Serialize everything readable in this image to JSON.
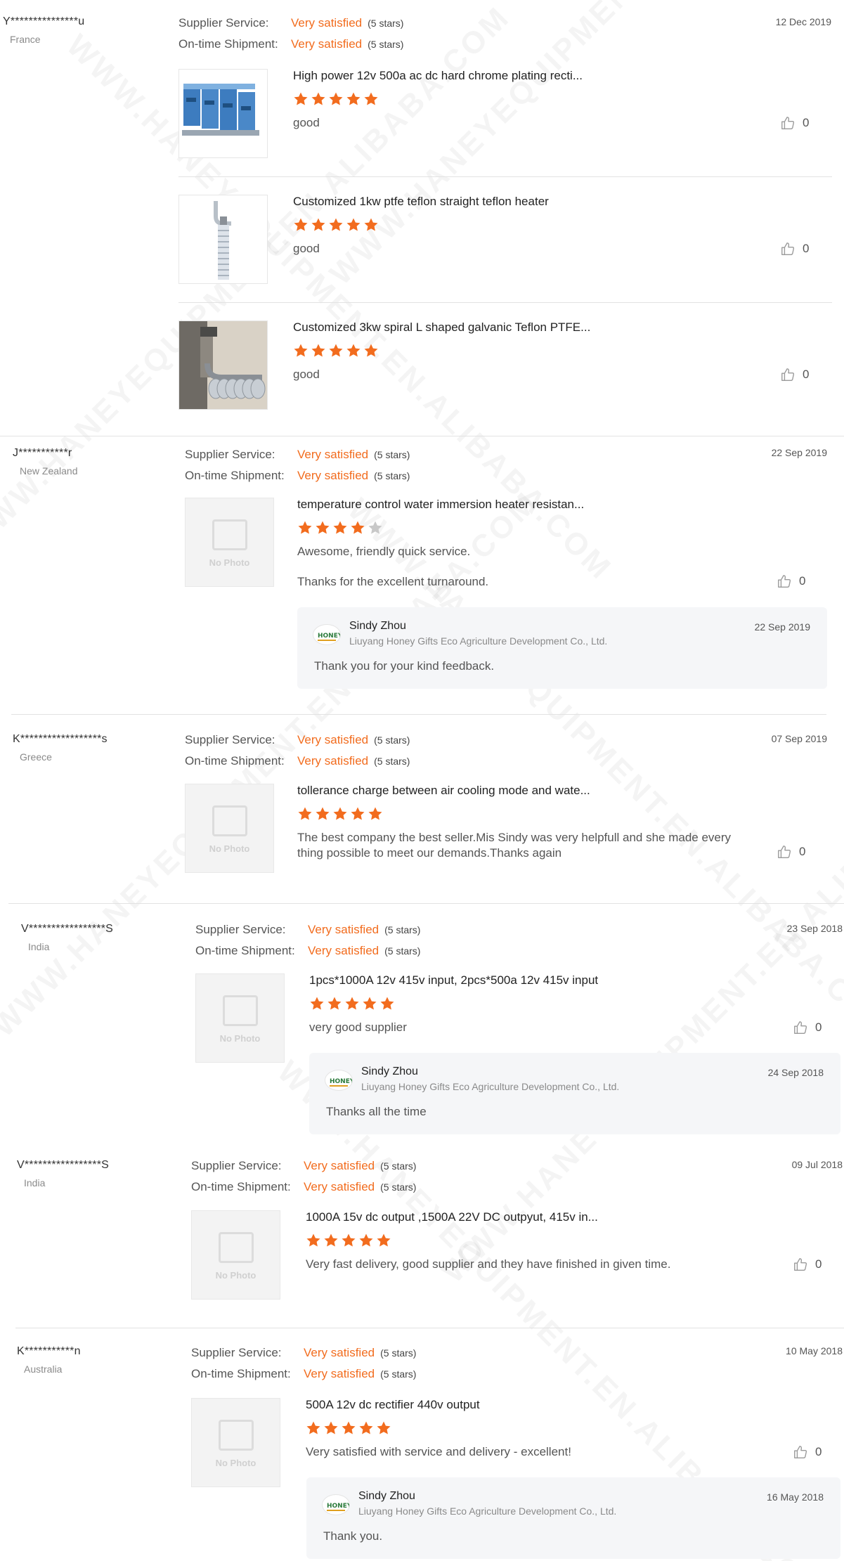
{
  "labels": {
    "supplier_service": "Supplier Service:",
    "ontime_shipment": "On-time Shipment:",
    "no_photo": "No Photo"
  },
  "colors": {
    "accent": "#f26c1e",
    "star_empty": "#c8c8c8"
  },
  "watermark": "WWW.HANEYEQUIPMENT.EN.ALIBABA.COM",
  "reviews": [
    {
      "buyer": "Y***************u",
      "country": "France",
      "date": "12 Dec 2019",
      "supplier_service": "Very satisfied",
      "supplier_service_stars": "(5 stars)",
      "ontime_shipment": "Very satisfied",
      "ontime_shipment_stars": "(5 stars)",
      "products": [
        {
          "title": "High power 12v 500a ac dc hard chrome plating recti...",
          "rating": 5,
          "comment": "good",
          "likes": "0",
          "image": "rectifier-photo"
        },
        {
          "title": "Customized 1kw ptfe teflon straight teflon heater",
          "rating": 5,
          "comment": "good",
          "likes": "0",
          "image": "heater-photo"
        },
        {
          "title": "Customized 3kw spiral L shaped galvanic Teflon PTFE...",
          "rating": 5,
          "comment": "good",
          "likes": "0",
          "image": "spiral-heater-photo"
        }
      ]
    },
    {
      "buyer": "J***********r",
      "country": "New Zealand",
      "date": "22 Sep 2019",
      "supplier_service": "Very satisfied",
      "supplier_service_stars": "(5 stars)",
      "ontime_shipment": "Very satisfied",
      "ontime_shipment_stars": "(5 stars)",
      "products": [
        {
          "title": "temperature control water immersion heater resistan...",
          "rating": 4,
          "comment": "Awesome, friendly quick service.",
          "comment2": "Thanks for the excellent turnaround.",
          "likes": "0",
          "image": "no-photo"
        }
      ],
      "reply": {
        "name": "Sindy Zhou",
        "company": "Liuyang Honey Gifts Eco Agriculture Development Co., Ltd.",
        "date": "22 Sep 2019",
        "text": "Thank  you for your kind feedback."
      }
    },
    {
      "buyer": "K******************s",
      "country": "Greece",
      "date": "07 Sep 2019",
      "supplier_service": "Very satisfied",
      "supplier_service_stars": "(5 stars)",
      "ontime_shipment": "Very satisfied",
      "ontime_shipment_stars": "(5 stars)",
      "products": [
        {
          "title": "tollerance charge between air cooling mode and wate...",
          "rating": 5,
          "comment": "The best company the best seller.Mis Sindy was very helpfull and she made every thing possible to meet our demands.Thanks again",
          "likes": "0",
          "image": "no-photo"
        }
      ]
    },
    {
      "buyer": "V*****************S",
      "country": "India",
      "date": "23 Sep 2018",
      "supplier_service": "Very satisfied",
      "supplier_service_stars": "(5 stars)",
      "ontime_shipment": "Very satisfied",
      "ontime_shipment_stars": "(5 stars)",
      "products": [
        {
          "title": "1pcs*1000A 12v 415v input, 2pcs*500a 12v 415v input",
          "rating": 5,
          "comment": "very good supplier",
          "likes": "0",
          "image": "no-photo"
        }
      ],
      "reply": {
        "name": "Sindy Zhou",
        "company": "Liuyang Honey Gifts Eco Agriculture Development Co., Ltd.",
        "date": "24 Sep 2018",
        "text": "Thanks all the time"
      }
    },
    {
      "buyer": "V*****************S",
      "country": "India",
      "date": "09 Jul 2018",
      "supplier_service": "Very satisfied",
      "supplier_service_stars": "(5 stars)",
      "ontime_shipment": "Very satisfied",
      "ontime_shipment_stars": "(5 stars)",
      "products": [
        {
          "title": "1000A 15v dc output ,1500A 22V DC outpyut, 415v in...",
          "rating": 5,
          "comment": "Very fast delivery, good supplier and they have finished in given time.",
          "likes": "0",
          "image": "no-photo"
        }
      ]
    },
    {
      "buyer": "K***********n",
      "country": "Australia",
      "date": "10 May 2018",
      "supplier_service": "Very satisfied",
      "supplier_service_stars": "(5 stars)",
      "ontime_shipment": "Very satisfied",
      "ontime_shipment_stars": "(5 stars)",
      "products": [
        {
          "title": "500A 12v dc rectifier 440v output",
          "rating": 5,
          "comment": "Very satisfied with service and delivery - excellent!",
          "likes": "0",
          "image": "no-photo"
        }
      ],
      "reply": {
        "name": "Sindy Zhou",
        "company": "Liuyang Honey Gifts Eco Agriculture Development Co., Ltd.",
        "date": "16 May 2018",
        "text": "Thank you."
      }
    }
  ]
}
